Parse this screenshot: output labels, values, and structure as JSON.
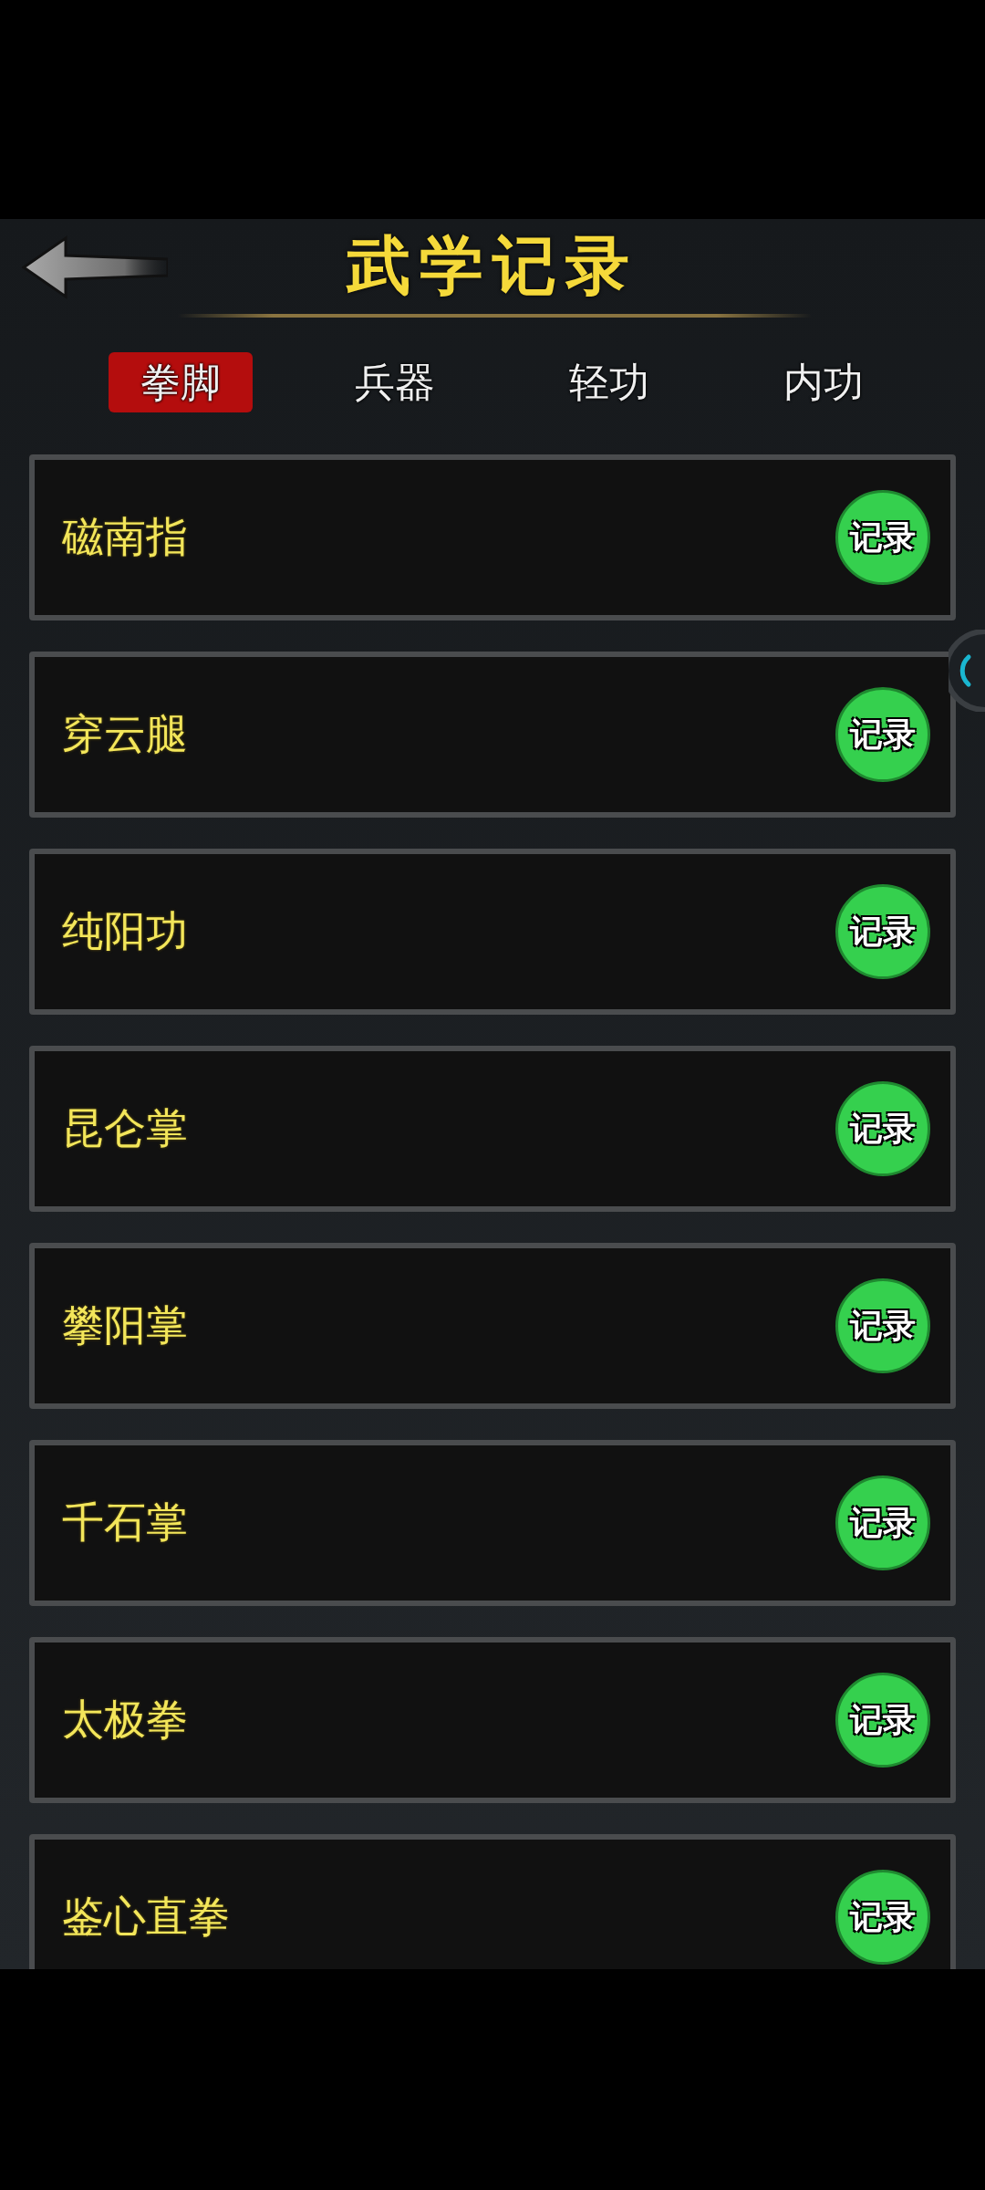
{
  "header": {
    "title": "武学记录"
  },
  "tabs": [
    {
      "label": "拳脚",
      "selected": true
    },
    {
      "label": "兵器",
      "selected": false
    },
    {
      "label": "轻功",
      "selected": false
    },
    {
      "label": "内功",
      "selected": false
    }
  ],
  "skills": [
    {
      "name": "磁南指",
      "button": "记录"
    },
    {
      "name": "穿云腿",
      "button": "记录"
    },
    {
      "name": "纯阳功",
      "button": "记录"
    },
    {
      "name": "昆仑掌",
      "button": "记录"
    },
    {
      "name": "攀阳掌",
      "button": "记录"
    },
    {
      "name": "千石掌",
      "button": "记录"
    },
    {
      "name": "太极拳",
      "button": "记录"
    },
    {
      "name": "鉴心直拳",
      "button": "记录"
    }
  ]
}
